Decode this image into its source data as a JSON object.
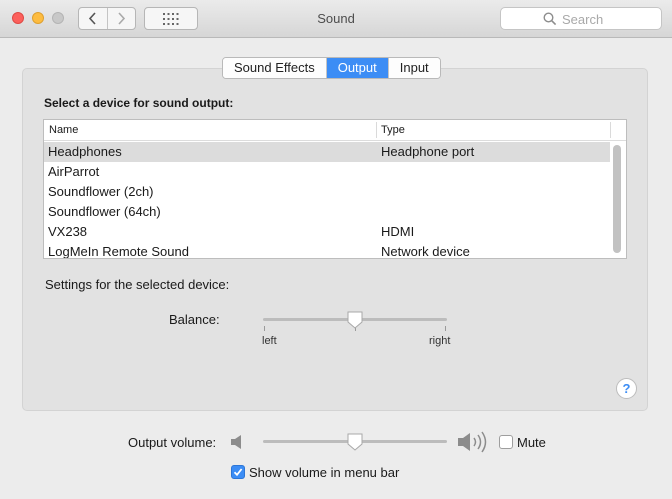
{
  "window": {
    "title": "Sound",
    "search_placeholder": "Search",
    "traffic_lights": [
      "close",
      "minimize",
      "zoom"
    ],
    "icons": {
      "back": "chevron-left-icon",
      "forward": "chevron-right-icon",
      "show_all": "grid-icon",
      "search": "search-icon"
    }
  },
  "tabs": [
    {
      "label": "Sound Effects",
      "active": false
    },
    {
      "label": "Output",
      "active": true
    },
    {
      "label": "Input",
      "active": false
    }
  ],
  "output": {
    "heading": "Select a device for sound output:",
    "columns": {
      "name": "Name",
      "type": "Type"
    },
    "devices": [
      {
        "name": "Headphones",
        "type": "Headphone port",
        "selected": true
      },
      {
        "name": "AirParrot",
        "type": ""
      },
      {
        "name": "Soundflower (2ch)",
        "type": ""
      },
      {
        "name": "Soundflower (64ch)",
        "type": ""
      },
      {
        "name": "VX238",
        "type": "HDMI"
      },
      {
        "name": "LogMeIn Remote Sound",
        "type": "Network device"
      }
    ],
    "settings_label": "Settings for the selected device:",
    "balance": {
      "label": "Balance:",
      "left_label": "left",
      "right_label": "right",
      "value": 0.5
    }
  },
  "help_label": "?",
  "volume": {
    "label": "Output volume:",
    "value": 0.5,
    "low_icon": "speaker-low-icon",
    "high_icon": "speaker-high-icon",
    "mute_label": "Mute",
    "muted": false
  },
  "menu_bar": {
    "label": "Show volume in menu bar",
    "checked": true
  },
  "colors": {
    "accent": "#3c8df5",
    "close": "#fc605c",
    "minimize": "#fdbc40"
  }
}
